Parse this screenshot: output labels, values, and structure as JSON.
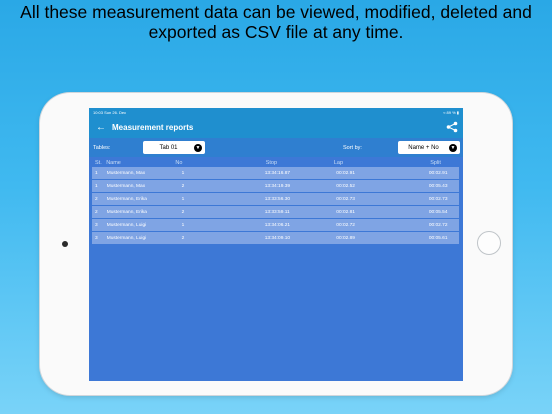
{
  "caption": {
    "line1": "All these measurement data can be viewed, modified, deleted and",
    "line2": "exported as CSV file at any time."
  },
  "statusbar": {
    "time_date": "10:03  Sun 26. Dec",
    "battery": "89 %"
  },
  "navbar": {
    "title": "Measurement reports",
    "back_icon": "arrow-left-icon",
    "share_icon": "share-icon"
  },
  "toolbar": {
    "tables_label": "Tables:",
    "tables_value": "Tab 01",
    "sort_label": "Sort by:",
    "sort_value": "Name + No"
  },
  "table": {
    "headers": [
      "St.",
      "Name",
      "No",
      "Stop",
      "Lap",
      "Split"
    ],
    "rows": [
      [
        "1",
        "Mustermann, Max",
        "1",
        "13:34:16.87",
        "00:02.91",
        "00:02.91"
      ],
      [
        "1",
        "Mustermann, Max",
        "2",
        "13:34:19.39",
        "00:02.52",
        "00:05.43"
      ],
      [
        "2",
        "Mustermann, Erika",
        "1",
        "13:33:56.30",
        "00:02.73",
        "00:02.73"
      ],
      [
        "2",
        "Mustermann, Erika",
        "2",
        "13:33:59.11",
        "00:02.81",
        "00:05.54"
      ],
      [
        "3",
        "Mustermann, Luigi",
        "1",
        "13:34:06.21",
        "00:02.72",
        "00:02.72"
      ],
      [
        "3",
        "Mustermann, Luigi",
        "2",
        "13:34:09.10",
        "00:02.89",
        "00:05.61"
      ]
    ]
  },
  "colors": {
    "navbar": "#1f8fcf",
    "screen_bg": "#3d78d6",
    "row_bg": "#7fa4e4"
  }
}
